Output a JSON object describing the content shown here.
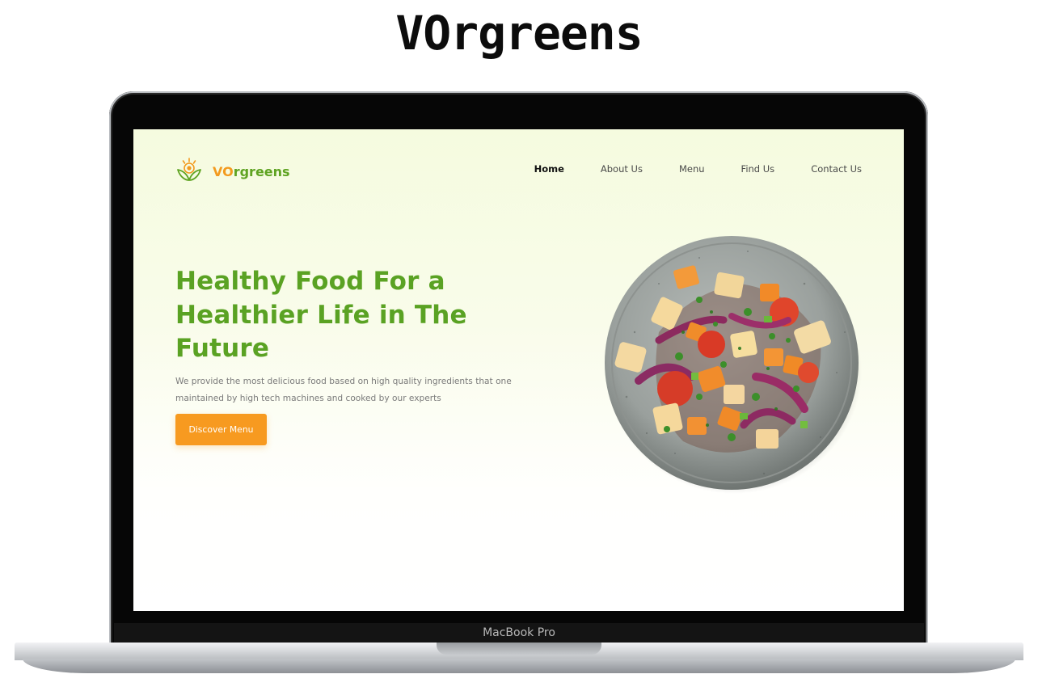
{
  "showcase": {
    "heading": "VOrgreens",
    "device_label": "MacBook Pro"
  },
  "site": {
    "logo": {
      "part1": "VO",
      "part2": "rgreens",
      "icon": "leaf-sun-icon"
    },
    "nav": [
      {
        "label": "Home",
        "active": true
      },
      {
        "label": "About Us",
        "active": false
      },
      {
        "label": "Menu",
        "active": false
      },
      {
        "label": "Find Us",
        "active": false
      },
      {
        "label": "Contact Us",
        "active": false
      }
    ],
    "hero": {
      "title": "Healthy Food For a Healthier Life in The Future",
      "description": "We provide the most delicious food based on high quality ingredients that one maintained by high tech machines and cooked by our experts",
      "cta_label": "Discover Menu",
      "image": "salad-plate-image"
    }
  },
  "colors": {
    "brand_green": "#5aa223",
    "brand_orange": "#f79a20",
    "hero_background": "#f5fbdf"
  }
}
